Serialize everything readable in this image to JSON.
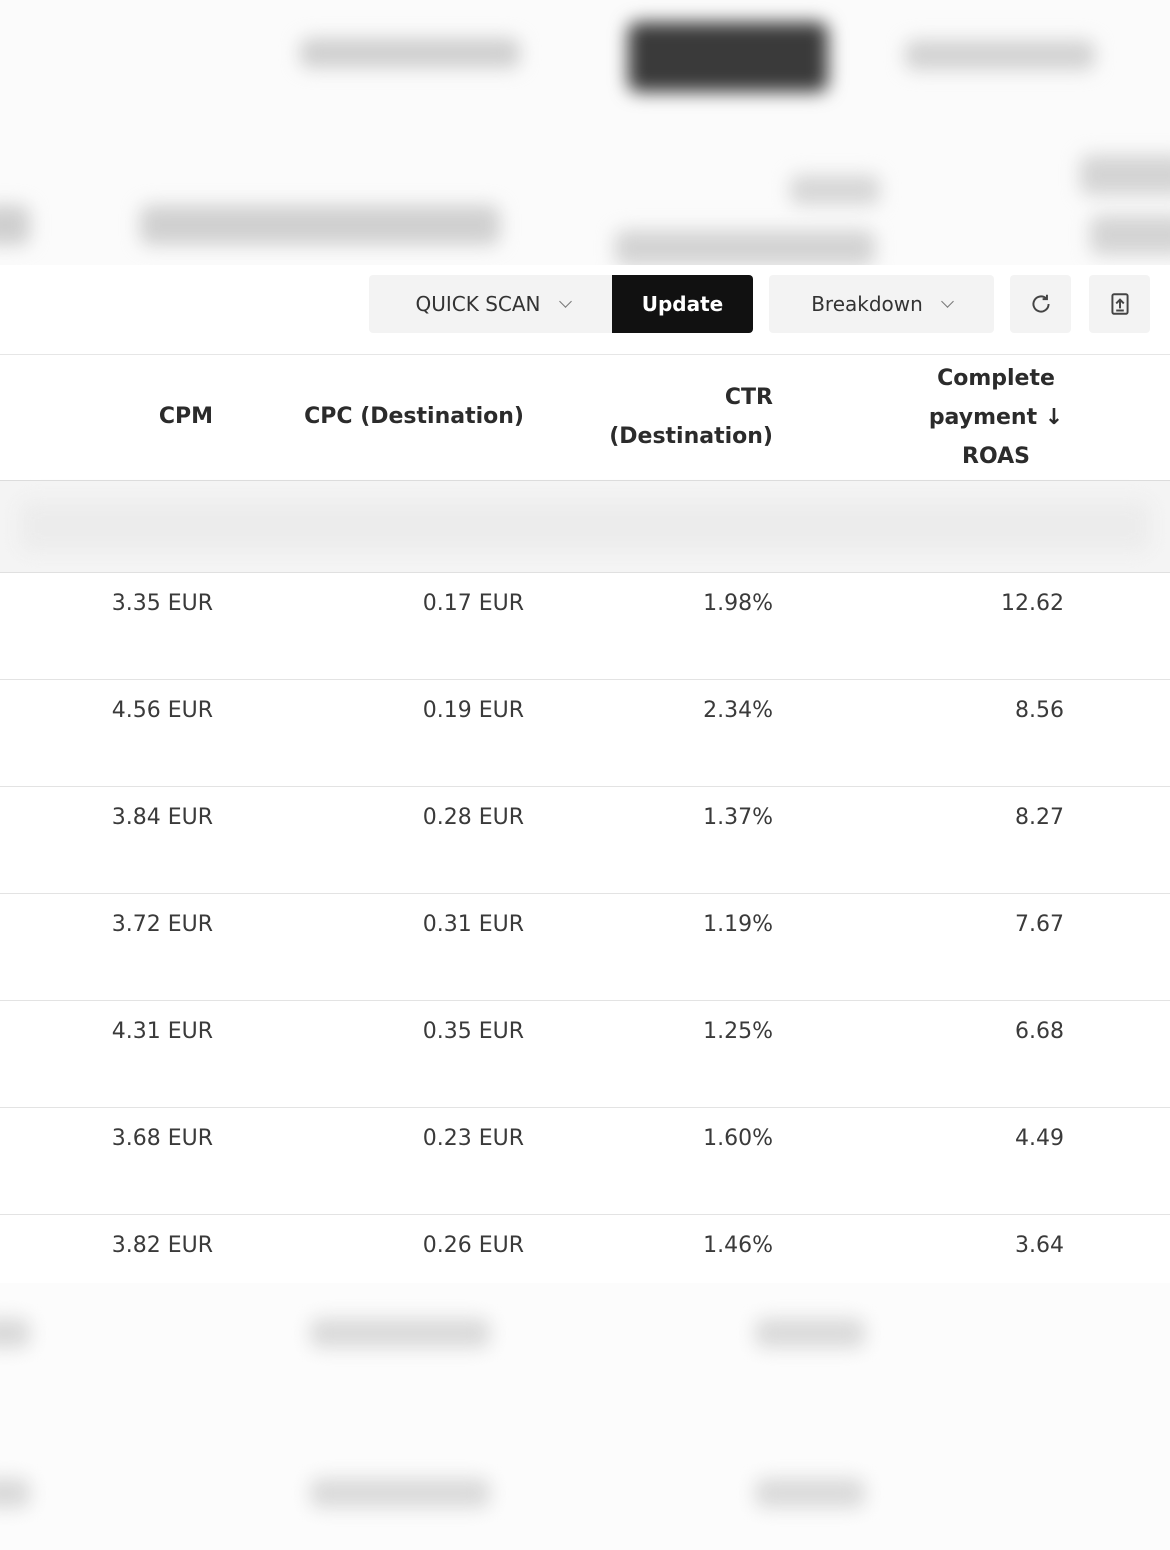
{
  "toolbar": {
    "quick_scan_label": "QUICK SCAN",
    "update_label": "Update",
    "breakdown_label": "Breakdown",
    "refresh_icon": "refresh-icon",
    "export_icon": "export-icon"
  },
  "table": {
    "columns": {
      "cpm": "CPM",
      "cpc": "CPC (Destination)",
      "ctr_line1": "CTR",
      "ctr_line2": "(Destination)",
      "roas_line1": "Complete",
      "roas_line2": "payment ↓",
      "roas_line3": "ROAS"
    },
    "rows": [
      {
        "cpm": "3.35 EUR",
        "cpc": "0.17 EUR",
        "ctr": "1.98%",
        "roas": "12.62"
      },
      {
        "cpm": "4.56 EUR",
        "cpc": "0.19 EUR",
        "ctr": "2.34%",
        "roas": "8.56"
      },
      {
        "cpm": "3.84 EUR",
        "cpc": "0.28 EUR",
        "ctr": "1.37%",
        "roas": "8.27"
      },
      {
        "cpm": "3.72 EUR",
        "cpc": "0.31 EUR",
        "ctr": "1.19%",
        "roas": "7.67"
      },
      {
        "cpm": "4.31 EUR",
        "cpc": "0.35 EUR",
        "ctr": "1.25%",
        "roas": "6.68"
      },
      {
        "cpm": "3.68 EUR",
        "cpc": "0.23 EUR",
        "ctr": "1.60%",
        "roas": "4.49"
      },
      {
        "cpm": "3.82 EUR",
        "cpc": "0.26 EUR",
        "ctr": "1.46%",
        "roas": "3.64"
      }
    ]
  }
}
